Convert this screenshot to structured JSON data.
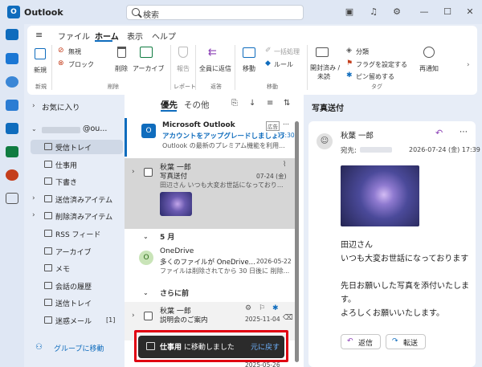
{
  "app": {
    "title": "Outlook"
  },
  "search": {
    "placeholder": "検索"
  },
  "ribbon": {
    "tabs": [
      "ファイル",
      "ホーム",
      "表示",
      "ヘルプ"
    ],
    "buttons": {
      "new": "新規",
      "ignore": "無視",
      "block": "ブロック",
      "delete": "削除",
      "archive": "アーカイブ",
      "report": "報告",
      "reply_all": "全員に返信",
      "move": "移動",
      "sweep": "一括処理",
      "rules": "ルール",
      "read_unread_1": "開封済み /",
      "read_unread_2": "未読",
      "categorize": "分類",
      "flag": "フラグを設定する",
      "pin": "ピン留めする",
      "snooze": "再通知"
    },
    "groups": {
      "new": "新規",
      "delete": "削除",
      "report": "レポート",
      "respond": "返答",
      "move": "移動",
      "tags": "タグ"
    }
  },
  "folders": {
    "favorites": "お気に入り",
    "account_suffix": "@ou...",
    "items": [
      {
        "label": "受信トレイ",
        "icon": "inbox-icon",
        "selected": true
      },
      {
        "label": "仕事用",
        "icon": "folder-icon"
      },
      {
        "label": "下書き",
        "icon": "pencil-icon"
      },
      {
        "label": "送信済みアイテム",
        "icon": "send-icon"
      },
      {
        "label": "削除済みアイテム",
        "icon": "trash-icon"
      },
      {
        "label": "RSS フィード",
        "icon": "folder-icon"
      },
      {
        "label": "アーカイブ",
        "icon": "archive-icon"
      },
      {
        "label": "メモ",
        "icon": "note-icon"
      },
      {
        "label": "会話の履歴",
        "icon": "folder-icon"
      },
      {
        "label": "送信トレイ",
        "icon": "outbox-icon"
      },
      {
        "label": "迷惑メール",
        "icon": "junk-icon",
        "count": "[1]"
      }
    ],
    "go_to_groups": "グループに移動"
  },
  "list": {
    "tab_focused": "優先",
    "tab_other": "その他",
    "messages": [
      {
        "sender": "Microsoft Outlook",
        "badge": "広告",
        "subject": "アカウントをアップグレードしましょう",
        "time": "17:30",
        "preview": "Outlook の最新のプレミアム機能を利用..."
      },
      {
        "sender": "秋葉 一郎",
        "subject": "写真送付",
        "date": "07-24 (金)",
        "preview": "田辺さん いつも大変お世話になっており..."
      },
      {
        "sender": "OneDrive",
        "avatar": "O",
        "subject": "多くのファイルが OneDrive...",
        "date": "2026-05-22",
        "preview": "ファイルは削除されてから 30 日後に 削除..."
      },
      {
        "sender": "秋葉 一郎",
        "subject": "説明会のご案内",
        "date": "2025-11-04",
        "preview": ""
      },
      {
        "sender": "",
        "subject": "",
        "date": "2025-05-26",
        "preview": ""
      }
    ],
    "sections": [
      "5 月",
      "さらに前"
    ]
  },
  "reading": {
    "header": "写真送付",
    "sender": "秋葉 一郎",
    "to_label": "宛先:",
    "datetime": "2026-07-24 (金) 17:39",
    "body": [
      "田辺さん",
      "いつも大変お世話になっております",
      "",
      "先日お願いした写真を添付いたしま",
      "す。",
      "よろしくお願いいたします。"
    ],
    "reply": "返信",
    "forward": "転送"
  },
  "toast": {
    "message_prefix": "仕事用",
    "message_suffix": " に移動しました",
    "undo": "元に戻す"
  },
  "colors": {
    "accent": "#0f6cbd",
    "toast_bg": "#2b2b2b",
    "highlight": "#e00012"
  }
}
